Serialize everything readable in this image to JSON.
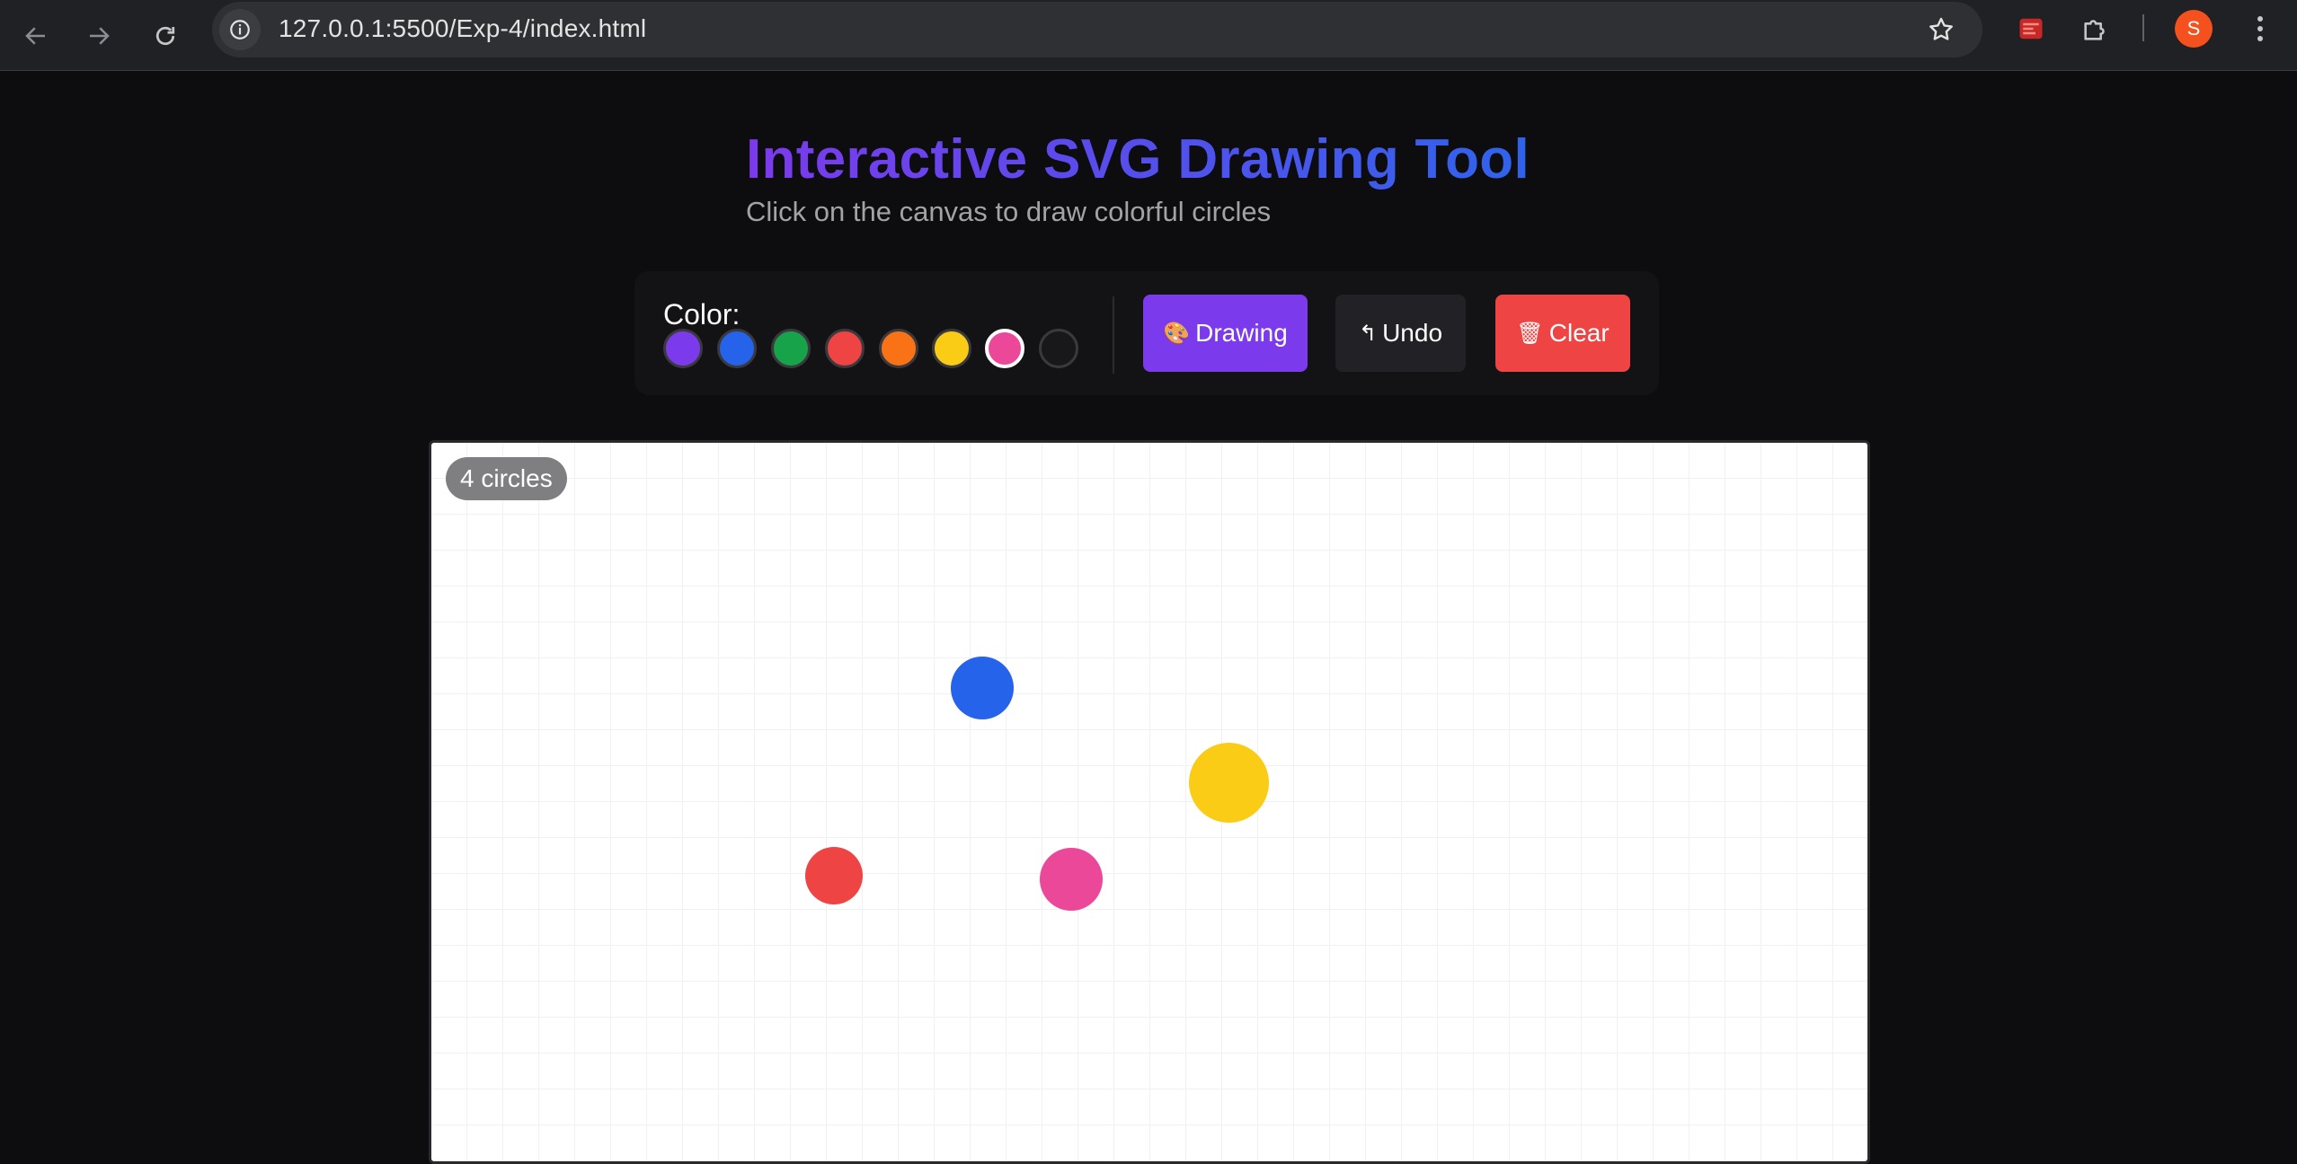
{
  "browser": {
    "url": "127.0.0.1:5500/Exp-4/index.html",
    "profile_initial": "S",
    "icons": [
      "back-arrow-icon",
      "forward-arrow-icon",
      "reload-icon",
      "site-info-icon",
      "bookmark-star-icon",
      "pdf-extension-icon",
      "extensions-puzzle-icon",
      "more-menu-icon"
    ]
  },
  "page": {
    "title": "Interactive SVG Drawing Tool",
    "subtitle": "Click on the canvas to draw colorful circles"
  },
  "toolbar": {
    "color_label": "Color:",
    "swatches": [
      {
        "name": "purple",
        "color": "#7c3aed",
        "selected": false
      },
      {
        "name": "blue",
        "color": "#2563eb",
        "selected": false
      },
      {
        "name": "green",
        "color": "#16a34a",
        "selected": false
      },
      {
        "name": "red",
        "color": "#ef4444",
        "selected": false
      },
      {
        "name": "orange",
        "color": "#f97316",
        "selected": false
      },
      {
        "name": "yellow",
        "color": "#facc15",
        "selected": false
      },
      {
        "name": "pink",
        "color": "#ec4899",
        "selected": true
      },
      {
        "name": "black",
        "color": "#18181b",
        "selected": false
      }
    ],
    "draw_icon": "🎨",
    "draw_label": "Drawing",
    "undo_icon": "↰",
    "undo_label": "Undo",
    "clear_icon": "🗑",
    "clear_label": "Clear"
  },
  "canvas": {
    "count_label": "4 circles",
    "circles": [
      {
        "color": "#2563eb"
      },
      {
        "color": "#facc15"
      },
      {
        "color": "#ef4444"
      },
      {
        "color": "#ec4899"
      }
    ]
  }
}
